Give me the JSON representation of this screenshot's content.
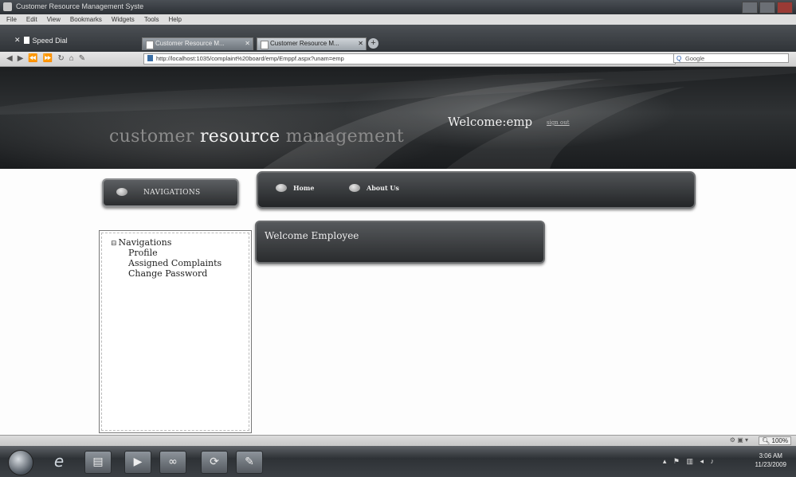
{
  "window": {
    "title": "Customer Resource Management Syste"
  },
  "menu": [
    "File",
    "Edit",
    "View",
    "Bookmarks",
    "Widgets",
    "Tools",
    "Help"
  ],
  "tabs": [
    {
      "label": "Speed Dial"
    },
    {
      "label": "Customer Resource M..."
    },
    {
      "label": "Customer Resource M..."
    }
  ],
  "address": {
    "url": "http://localhost:1035/complaint%20board/emp/Emppf.aspx?unam=emp",
    "search_placeholder": "Google"
  },
  "header": {
    "brand_part1": "customer ",
    "brand_part2": "resource",
    "brand_part3": " management",
    "welcome": "Welcome:emp",
    "signout": "sign out"
  },
  "nav_header": {
    "label": "NAVIGATIONS"
  },
  "topnav": {
    "home": "Home",
    "about": "About Us"
  },
  "tree": {
    "toggle": "⊟",
    "root": "Navigations",
    "children": [
      "Profile",
      "Assigned Complaints",
      "Change Password"
    ]
  },
  "main": {
    "welcome_text": "Welcome Employee"
  },
  "status": {
    "zoom": "100%"
  },
  "taskbar": {
    "time": "3:06 AM",
    "date": "11/23/2009"
  }
}
